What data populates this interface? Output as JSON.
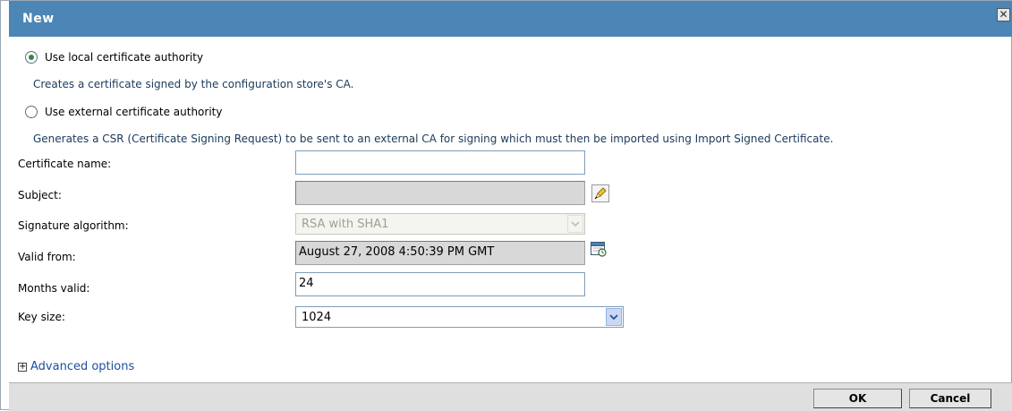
{
  "dialog": {
    "title": "New",
    "close_glyph": "✕"
  },
  "options": [
    {
      "label": "Use local certificate authority",
      "checked": true,
      "description": "Creates a certificate signed by the configuration store's CA."
    },
    {
      "label": "Use external certificate authority",
      "checked": false,
      "description": "Generates a CSR (Certificate Signing Request) to be sent to an external CA for signing which must then be imported using Import Signed Certificate."
    }
  ],
  "form": {
    "certificate_name": {
      "label": "Certificate name:",
      "value": ""
    },
    "subject": {
      "label": "Subject:",
      "value": "",
      "edit_icon": "pencil-icon"
    },
    "signature_algorithm": {
      "label": "Signature algorithm:",
      "value": "RSA with SHA1"
    },
    "valid_from": {
      "label": "Valid from:",
      "value": "August 27, 2008 4:50:39 PM GMT",
      "calendar_icon": "calendar-icon"
    },
    "months_valid": {
      "label": "Months valid:",
      "value": "24"
    },
    "key_size": {
      "label": "Key size:",
      "value": "1024"
    }
  },
  "advanced": {
    "expander": "+",
    "label": "Advanced options"
  },
  "footer": {
    "ok_label": "OK",
    "cancel_label": "Cancel"
  },
  "colors": {
    "titlebar": "#4b86b6",
    "link": "#1c4fa0",
    "footer": "#dfdfdf"
  }
}
